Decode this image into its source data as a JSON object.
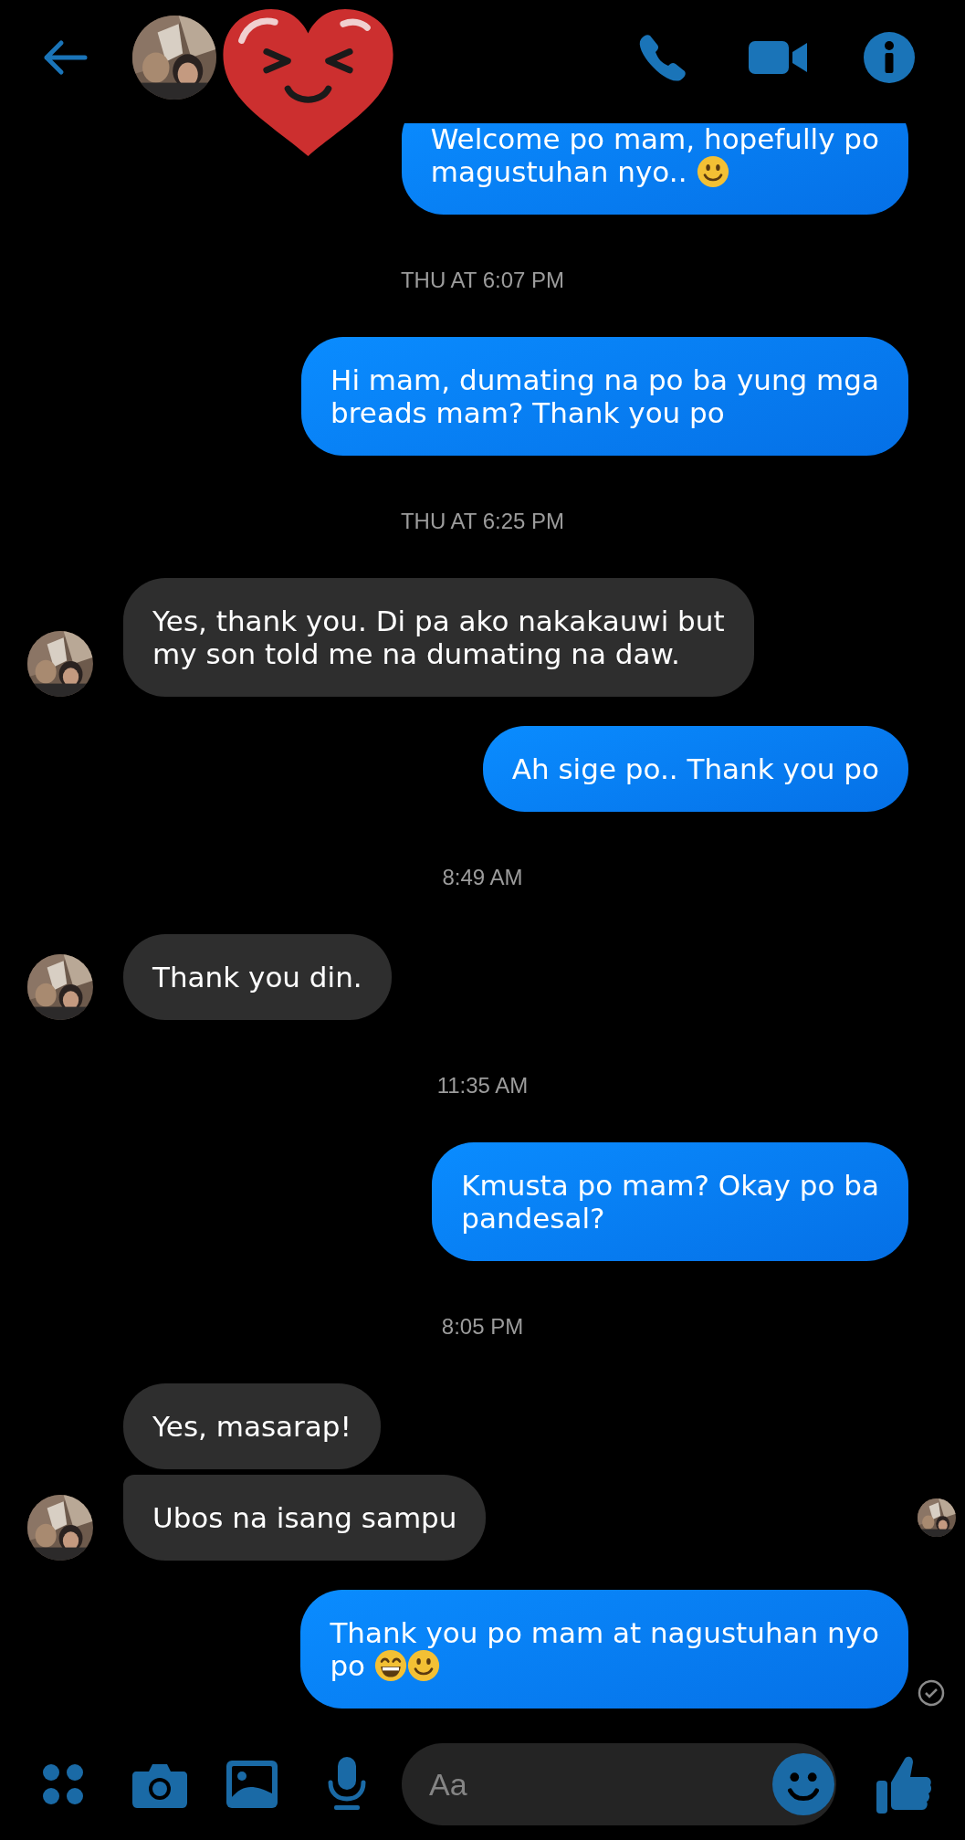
{
  "messages": [
    {
      "kind": "sent",
      "lines": [
        "Welcome po mam, hopefully po",
        "magustuhan nyo.."
      ],
      "emojis": [
        {
          "kind": "smile"
        }
      ],
      "delivered": false
    },
    {
      "kind": "time",
      "text": "THU AT 6:07 PM"
    },
    {
      "kind": "sent",
      "lines": [
        "Hi mam, dumating na po ba yung mga",
        "breads mam? Thank you po"
      ],
      "delivered": false
    },
    {
      "kind": "time",
      "text": "THU AT 6:25 PM"
    },
    {
      "kind": "received",
      "lines": [
        "Yes, thank you. Di pa ako nakakauwi but",
        "my son told me na dumating na daw."
      ],
      "show_avatar": true,
      "grouped": false,
      "seen_here": false
    },
    {
      "kind": "sent",
      "lines": [
        "Ah sige po.. Thank you po"
      ],
      "delivered": false
    },
    {
      "kind": "time",
      "text": "8:49 AM"
    },
    {
      "kind": "received",
      "lines": [
        "Thank you din."
      ],
      "show_avatar": true,
      "grouped": false,
      "seen_here": false
    },
    {
      "kind": "time",
      "text": "11:35 AM"
    },
    {
      "kind": "sent",
      "lines": [
        "Kmusta po mam? Okay po ba",
        "pandesal?"
      ],
      "delivered": false
    },
    {
      "kind": "time",
      "text": "8:05 PM"
    },
    {
      "kind": "received",
      "lines": [
        "Yes, masarap!"
      ],
      "show_avatar": false,
      "grouped": false,
      "seen_here": false
    },
    {
      "kind": "received",
      "lines": [
        "Ubos na isang sampu"
      ],
      "show_avatar": true,
      "grouped": true,
      "seen_here": true
    },
    {
      "kind": "sent",
      "lines": [
        "Thank you po mam at nagustuhan nyo",
        "po"
      ],
      "emojis": [
        {
          "kind": "grin"
        },
        {
          "kind": "smile"
        }
      ],
      "delivered": true
    }
  ],
  "composer": {
    "placeholder": "Aa"
  }
}
